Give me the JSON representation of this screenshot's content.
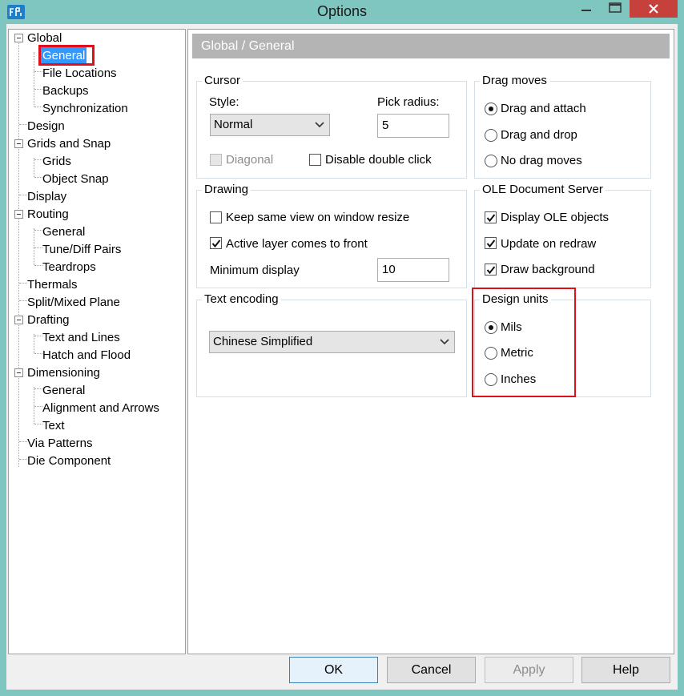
{
  "window": {
    "title": "Options"
  },
  "tree": {
    "items": [
      {
        "label": "Global"
      },
      {
        "label": "General"
      },
      {
        "label": "File Locations"
      },
      {
        "label": "Backups"
      },
      {
        "label": "Synchronization"
      },
      {
        "label": "Design"
      },
      {
        "label": "Grids and Snap"
      },
      {
        "label": "Grids"
      },
      {
        "label": "Object Snap"
      },
      {
        "label": "Display"
      },
      {
        "label": "Routing"
      },
      {
        "label": "General"
      },
      {
        "label": "Tune/Diff Pairs"
      },
      {
        "label": "Teardrops"
      },
      {
        "label": "Thermals"
      },
      {
        "label": "Split/Mixed Plane"
      },
      {
        "label": "Drafting"
      },
      {
        "label": "Text and Lines"
      },
      {
        "label": "Hatch and Flood"
      },
      {
        "label": "Dimensioning"
      },
      {
        "label": "General"
      },
      {
        "label": "Alignment and Arrows"
      },
      {
        "label": "Text"
      },
      {
        "label": "Via Patterns"
      },
      {
        "label": "Die Component"
      }
    ],
    "selected": "General"
  },
  "header": {
    "title": "Global / General"
  },
  "cursor": {
    "title": "Cursor",
    "style_label": "Style:",
    "style_value": "Normal",
    "pick_radius_label": "Pick radius:",
    "pick_radius_value": "5",
    "diagonal_label": "Diagonal",
    "diagonal_checked": false,
    "diagonal_enabled": false,
    "disable_double_click_label": "Disable double click",
    "disable_double_click_checked": false
  },
  "drag_moves": {
    "title": "Drag moves",
    "options": [
      "Drag and attach",
      "Drag and drop",
      "No drag moves"
    ],
    "selected": "Drag and attach"
  },
  "drawing": {
    "title": "Drawing",
    "keep_same_view_label": "Keep same view on window resize",
    "keep_same_view_checked": false,
    "active_layer_label": "Active layer comes to front",
    "active_layer_checked": true,
    "min_display_label": "Minimum display",
    "min_display_value": "10"
  },
  "ole": {
    "title": "OLE Document Server",
    "display_ole_label": "Display OLE objects",
    "update_on_redraw_label": "Update on redraw",
    "draw_background_label": "Draw background",
    "all_checked": true
  },
  "text_encoding": {
    "title": "Text encoding",
    "value": "Chinese Simplified"
  },
  "design_units": {
    "title": "Design units",
    "options": [
      "Mils",
      "Metric",
      "Inches"
    ],
    "selected": "Mils"
  },
  "buttons": {
    "ok": "OK",
    "cancel": "Cancel",
    "apply": "Apply",
    "help": "Help"
  },
  "colors": {
    "titlebar": "#7fc5c0",
    "close_button": "#c7413c",
    "selection": "#3399ff",
    "annotation_box": "#e0101a"
  }
}
